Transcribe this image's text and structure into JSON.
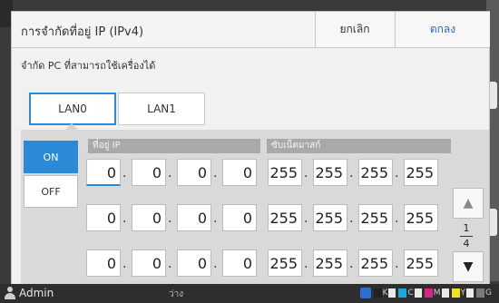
{
  "dialog": {
    "title": "การจำกัดที่อยู่ IP (IPv4)",
    "cancel_label": "ยกเลิก",
    "ok_label": "ตกลง",
    "subtitle": "จำกัด PC ที่สามารถใช้เครื่องได้"
  },
  "tabs": [
    {
      "label": "LAN0",
      "selected": true
    },
    {
      "label": "LAN1",
      "selected": false
    }
  ],
  "toggle": {
    "on_label": "ON",
    "off_label": "OFF",
    "selected": "ON"
  },
  "columns": {
    "ip": "ที่อยู่ IP",
    "mask": "ซับเน็ตมาสก์"
  },
  "rows": [
    {
      "ip": [
        "0",
        "0",
        "0",
        "0"
      ],
      "mask": [
        "255",
        "255",
        "255",
        "255"
      ]
    },
    {
      "ip": [
        "0",
        "0",
        "0",
        "0"
      ],
      "mask": [
        "255",
        "255",
        "255",
        "255"
      ]
    },
    {
      "ip": [
        "0",
        "0",
        "0",
        "0"
      ],
      "mask": [
        "255",
        "255",
        "255",
        "255"
      ]
    }
  ],
  "pager": {
    "current": "1",
    "total": "4"
  },
  "status": {
    "user": "Admin",
    "idle": "ว่าง",
    "inks": [
      {
        "label": "K",
        "color": "#222222"
      },
      {
        "label": "C",
        "color": "#1aa7e0"
      },
      {
        "label": "M",
        "color": "#d6248a"
      },
      {
        "label": "Y",
        "color": "#f2e21a"
      },
      {
        "label": "G",
        "color": "#7a7a7a"
      }
    ]
  },
  "colors": {
    "accent": "#2a8ad8",
    "ok_text": "#2a67c8"
  }
}
